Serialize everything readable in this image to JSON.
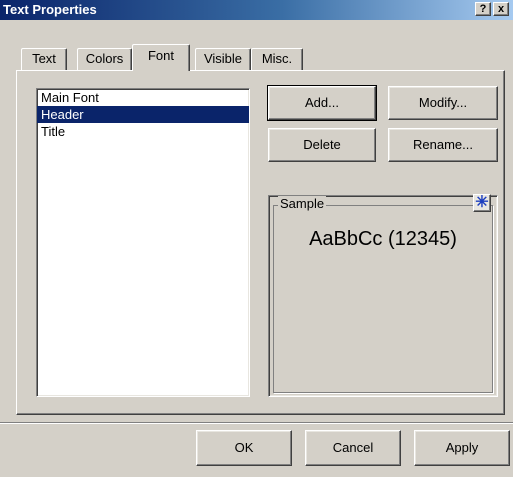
{
  "window": {
    "title": "Text Properties",
    "help_label": "?",
    "close_label": "x"
  },
  "tabs": [
    {
      "label": "Text"
    },
    {
      "label": "Colors"
    },
    {
      "label": "Font"
    },
    {
      "label": "Visible"
    },
    {
      "label": "Misc."
    }
  ],
  "active_tab": "Font",
  "font_list": {
    "items": [
      "Main Font",
      "Header",
      "Title"
    ],
    "selected": "Header"
  },
  "buttons": {
    "add": "Add...",
    "modify": "Modify...",
    "delete": "Delete",
    "rename": "Rename..."
  },
  "sample": {
    "label": "Sample",
    "text": "AaBbCc (12345)",
    "icon": "star-icon"
  },
  "footer": {
    "ok": "OK",
    "cancel": "Cancel",
    "apply": "Apply"
  },
  "colors": {
    "title_bar": "#0a246a",
    "selection": "#0a246a",
    "face": "#d4d0c8"
  }
}
